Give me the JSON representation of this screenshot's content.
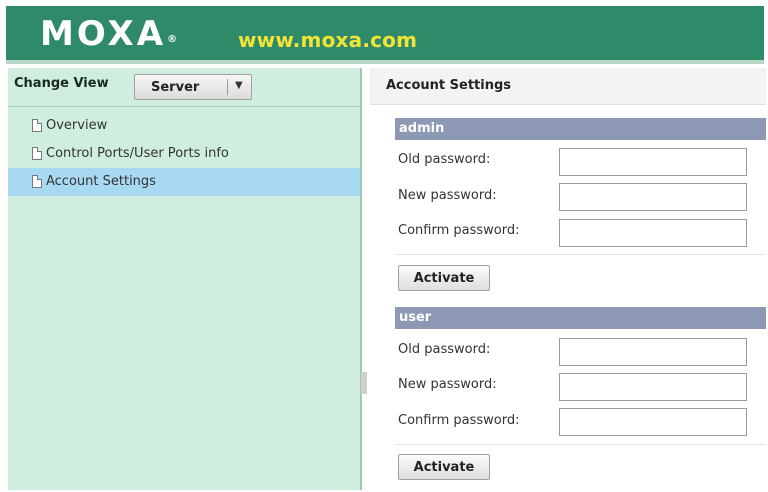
{
  "header": {
    "logo_text": "MOXA",
    "logo_registered": "®",
    "url_text": "www.moxa.com"
  },
  "sidebar": {
    "change_view_label": "Change View",
    "server_select_value": "Server",
    "items": [
      {
        "label": "Overview",
        "active": false
      },
      {
        "label": "Control Ports/User Ports info",
        "active": false
      },
      {
        "label": "Account Settings",
        "active": true
      }
    ]
  },
  "main": {
    "title": "Account Settings",
    "sections": [
      {
        "name": "admin",
        "fields": [
          {
            "label": "Old password:",
            "value": ""
          },
          {
            "label": "New password:",
            "value": ""
          },
          {
            "label": "Confirm password:",
            "value": ""
          }
        ],
        "button_label": "Activate"
      },
      {
        "name": "user",
        "fields": [
          {
            "label": "Old password:",
            "value": ""
          },
          {
            "label": "New password:",
            "value": ""
          },
          {
            "label": "Confirm password:",
            "value": ""
          }
        ],
        "button_label": "Activate"
      }
    ]
  },
  "colors": {
    "header_bg": "#2f8a6a",
    "url_color": "#f1e437",
    "sidebar_bg": "#cfeedd",
    "active_item_bg": "#a8d9f2",
    "section_header_bg": "#8c98b4"
  }
}
